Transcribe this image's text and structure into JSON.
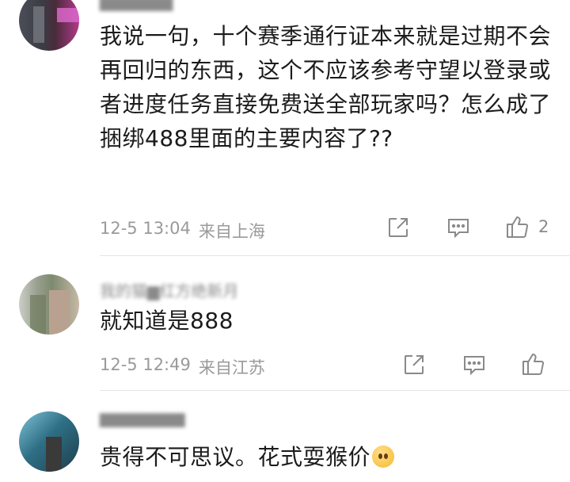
{
  "comments": [
    {
      "username": "▆▆▆▆▆▆",
      "content": "我说一句，十个赛季通行证本来就是过期不会再回归的东西，这个不应该参考守望以登录或者进度任务直接免费送全部玩家吗？怎么成了捆绑488里面的主要内容了??",
      "time": "12-5 13:04",
      "location": "来自上海",
      "likes": "2"
    },
    {
      "username": "我的猫▆红方绝新月",
      "content": "就知道是888",
      "time": "12-5 12:49",
      "location": "来自江苏",
      "likes": ""
    },
    {
      "username": "▆▆▆▆▆▆▆",
      "content": "贵得不可思议。花式耍猴价",
      "time": "",
      "location": "",
      "likes": ""
    }
  ],
  "icons": {
    "share": "share-icon",
    "comment": "comment-icon",
    "like": "thumbs-up-icon",
    "emoji": "crying-face-emoji-icon"
  },
  "colors": {
    "text": "#1b1b1b",
    "meta": "#9a9a9a",
    "icon": "#8a8a8a",
    "divider": "#e6e6e6"
  }
}
